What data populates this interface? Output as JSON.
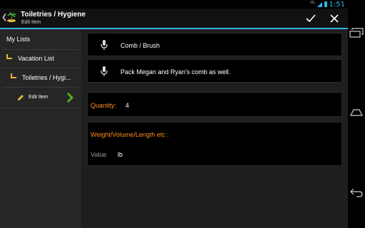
{
  "status_bar": {
    "network": "3G",
    "time": "1:51",
    "accent": "#33b5e5"
  },
  "action_bar": {
    "title": "Toiletries / Hygiene",
    "subtitle": "Edit Item",
    "icons": {
      "up": "chevron-left-icon",
      "logo": "island-icon",
      "confirm": "check-icon",
      "cancel": "close-icon"
    }
  },
  "sidebar": {
    "items": [
      {
        "label": "My Lists"
      },
      {
        "label": "Vacation List",
        "icon": "folder-icon"
      },
      {
        "label": "Toiletries / Hygi...",
        "icon": "folder-icon"
      },
      {
        "label": "Edit Item",
        "icon": "pencil-icon",
        "trailing_icon": "chevron-right-icon"
      }
    ]
  },
  "item": {
    "name": "Comb / Brush",
    "note": "Pack Megan and Ryan's comb as well.",
    "quantity_label": "Quantity:",
    "quantity_value": "4",
    "weight_label": "Weight/Volume/Length etc :",
    "value_label": "Value",
    "value_unit": "lb"
  },
  "colors": {
    "label_orange": "#ff8c1a",
    "sidebar_bg": "#262626",
    "content_bg": "#1e1e1e",
    "confirm_green": "#4caf1e"
  },
  "system_nav": {
    "icons": [
      "recent-apps-icon",
      "home-icon",
      "back-icon"
    ]
  }
}
